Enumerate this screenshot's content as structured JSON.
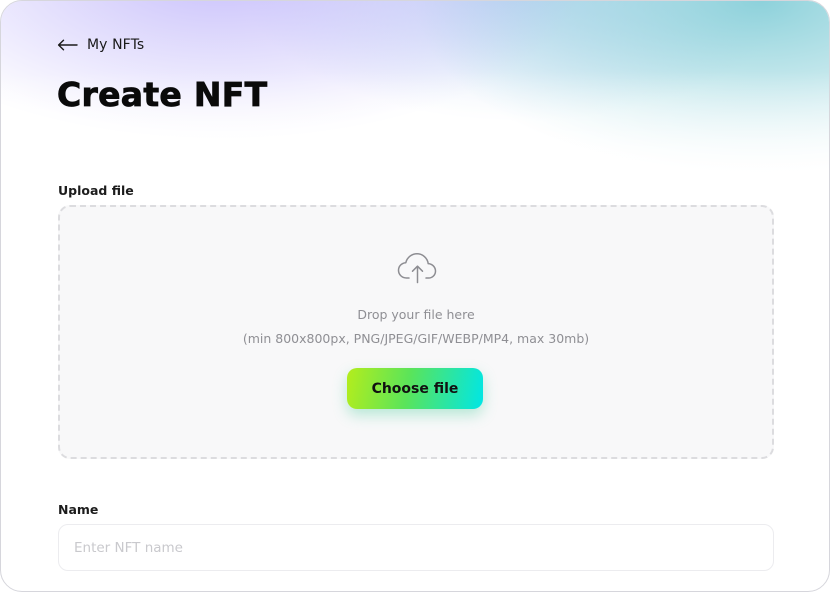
{
  "nav": {
    "back_label": "My NFTs",
    "back_icon": "arrow-left-icon"
  },
  "page": {
    "title": "Create NFT"
  },
  "upload": {
    "label": "Upload file",
    "icon": "cloud-upload-icon",
    "hint": "Drop your file here",
    "requirements": "(min 800x800px, PNG/JPEG/GIF/WEBP/MP4, max 30mb)",
    "button_label": "Choose file"
  },
  "name": {
    "label": "Name",
    "placeholder": "Enter NFT name",
    "value": ""
  },
  "colors": {
    "button_gradient_start": "#b4ed1c",
    "button_gradient_end": "#00e6e6",
    "title": "#0a0a0a"
  }
}
